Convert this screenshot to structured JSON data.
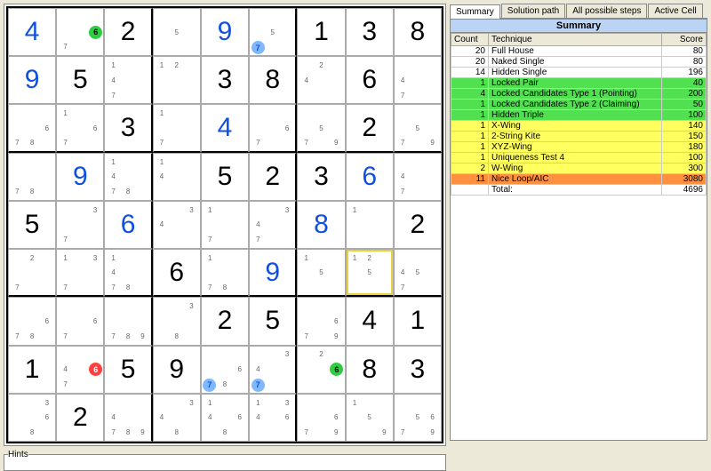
{
  "tabs": {
    "t0": "Summary",
    "t1": "Solution path",
    "t2": "All possible steps",
    "t3": "Active Cell"
  },
  "summary_header": "Summary",
  "columns": {
    "count": "Count",
    "tech": "Technique",
    "score": "Score"
  },
  "rows": [
    {
      "c": "20",
      "t": "Full House",
      "s": "80",
      "cls": "row-white"
    },
    {
      "c": "20",
      "t": "Naked Single",
      "s": "80",
      "cls": "row-white"
    },
    {
      "c": "14",
      "t": "Hidden Single",
      "s": "196",
      "cls": "row-white"
    },
    {
      "c": "1",
      "t": "Locked Pair",
      "s": "40",
      "cls": "row-green"
    },
    {
      "c": "4",
      "t": "Locked Candidates Type 1 (Pointing)",
      "s": "200",
      "cls": "row-green"
    },
    {
      "c": "1",
      "t": "Locked Candidates Type 2 (Claiming)",
      "s": "50",
      "cls": "row-green"
    },
    {
      "c": "1",
      "t": "Hidden Triple",
      "s": "100",
      "cls": "row-green"
    },
    {
      "c": "1",
      "t": "X-Wing",
      "s": "140",
      "cls": "row-yellow"
    },
    {
      "c": "1",
      "t": "2-String Kite",
      "s": "150",
      "cls": "row-yellow"
    },
    {
      "c": "1",
      "t": "XYZ-Wing",
      "s": "180",
      "cls": "row-yellow"
    },
    {
      "c": "1",
      "t": "Uniqueness Test 4",
      "s": "100",
      "cls": "row-yellow"
    },
    {
      "c": "2",
      "t": "W-Wing",
      "s": "300",
      "cls": "row-yellow"
    },
    {
      "c": "11",
      "t": "Nice Loop/AIC",
      "s": "3080",
      "cls": "row-orange"
    },
    {
      "c": "",
      "t": "Total:",
      "s": "4696",
      "cls": "row-white"
    }
  ],
  "hints_label": "Hints",
  "sudoku": {
    "rows": [
      [
        {
          "v": "4",
          "c": "blue"
        },
        {
          "cand": [
            "",
            "",
            "",
            "",
            "",
            "",
            "7",
            ""
          ],
          "circ": {
            "n": "6",
            "pos": [
              1,
              2
            ],
            "col": "green"
          }
        },
        {
          "v": "2",
          "c": "black"
        },
        {
          "cand": [
            "",
            "",
            "",
            "",
            "5",
            "",
            "",
            "",
            ""
          ]
        },
        {
          "v": "9",
          "c": "blue"
        },
        {
          "cand": [
            "",
            "",
            "",
            "",
            "5",
            "",
            "7",
            "",
            ""
          ],
          "circ": {
            "n": "7",
            "pos": [
              2,
              0
            ],
            "col": "blue"
          }
        },
        {
          "v": "1",
          "c": "black"
        },
        {
          "v": "3",
          "c": "black"
        },
        {
          "v": "8",
          "c": "black"
        }
      ],
      [
        {
          "v": "9",
          "c": "blue"
        },
        {
          "v": "5",
          "c": "black"
        },
        {
          "cand": [
            "1",
            "",
            "",
            "4",
            "",
            "",
            "7",
            "",
            ""
          ]
        },
        {
          "cand": [
            "1",
            "2",
            "",
            "",
            "",
            "",
            "",
            "",
            ""
          ]
        },
        {
          "v": "3",
          "c": "black"
        },
        {
          "v": "8",
          "c": "black"
        },
        {
          "cand": [
            "",
            "2",
            "",
            "4",
            "",
            "",
            "",
            "",
            ""
          ]
        },
        {
          "v": "6",
          "c": "black"
        },
        {
          "cand": [
            "",
            "",
            "",
            "4",
            "",
            "",
            "7",
            "",
            ""
          ]
        }
      ],
      [
        {
          "cand": [
            "",
            "",
            "",
            "",
            "",
            "6",
            "7",
            "8",
            ""
          ]
        },
        {
          "cand": [
            "1",
            "",
            "",
            "",
            "",
            "6",
            "7",
            "",
            ""
          ]
        },
        {
          "v": "3",
          "c": "black"
        },
        {
          "cand": [
            "1",
            "",
            "",
            "",
            "",
            "",
            "7",
            "",
            ""
          ]
        },
        {
          "v": "4",
          "c": "blue"
        },
        {
          "cand": [
            "",
            "",
            "",
            "",
            "",
            "6",
            "7",
            "",
            ""
          ]
        },
        {
          "cand": [
            "",
            "",
            "",
            "",
            "5",
            "",
            "7",
            "",
            "9"
          ]
        },
        {
          "v": "2",
          "c": "black"
        },
        {
          "cand": [
            "",
            "",
            "",
            "",
            "5",
            "",
            "7",
            "",
            "9"
          ]
        }
      ],
      [
        {
          "cand": [
            "",
            "",
            "",
            "",
            "",
            "",
            "7",
            "8",
            ""
          ]
        },
        {
          "v": "9",
          "c": "blue"
        },
        {
          "cand": [
            "1",
            "",
            "",
            "4",
            "",
            "",
            "7",
            "8",
            ""
          ]
        },
        {
          "cand": [
            "1",
            "",
            "",
            "4",
            "",
            "",
            "",
            "",
            ""
          ]
        },
        {
          "v": "5",
          "c": "black"
        },
        {
          "v": "2",
          "c": "black"
        },
        {
          "v": "3",
          "c": "black"
        },
        {
          "v": "6",
          "c": "blue"
        },
        {
          "cand": [
            "",
            "",
            "",
            "4",
            "",
            "",
            "7",
            "",
            ""
          ]
        }
      ],
      [
        {
          "v": "5",
          "c": "black"
        },
        {
          "cand": [
            "",
            "",
            "3",
            "",
            "",
            "",
            "7",
            "",
            ""
          ]
        },
        {
          "v": "6",
          "c": "blue"
        },
        {
          "cand": [
            "",
            "",
            "3",
            "4",
            "",
            "",
            "",
            "",
            ""
          ]
        },
        {
          "cand": [
            "1",
            "",
            "",
            "",
            "",
            "",
            "7",
            "",
            ""
          ]
        },
        {
          "cand": [
            "",
            "",
            "3",
            "4",
            "",
            "",
            "7",
            "",
            ""
          ]
        },
        {
          "v": "8",
          "c": "blue"
        },
        {
          "cand": [
            "1",
            "",
            "",
            "",
            "",
            "",
            "",
            "",
            ""
          ]
        },
        {
          "v": "2",
          "c": "black"
        }
      ],
      [
        {
          "cand": [
            "",
            "2",
            "",
            "",
            "",
            "",
            "7",
            "",
            ""
          ]
        },
        {
          "cand": [
            "1",
            "",
            "3",
            "",
            "",
            "",
            "7",
            "",
            ""
          ]
        },
        {
          "cand": [
            "1",
            "",
            "",
            "4",
            "",
            "",
            "7",
            "8",
            ""
          ]
        },
        {
          "v": "6",
          "c": "black"
        },
        {
          "cand": [
            "1",
            "",
            "",
            "",
            "",
            "",
            "7",
            "8",
            ""
          ]
        },
        {
          "v": "9",
          "c": "blue"
        },
        {
          "cand": [
            "1",
            "",
            "",
            "",
            "5",
            "",
            "",
            "",
            ""
          ]
        },
        {
          "cand": [
            "1",
            "2",
            "",
            "",
            "5",
            "",
            "",
            "",
            ""
          ],
          "hl": true
        },
        {
          "cand": [
            "",
            "",
            "",
            "4",
            "5",
            "",
            "7",
            "",
            ""
          ]
        }
      ],
      [
        {
          "cand": [
            "",
            "",
            "",
            "",
            "",
            "6",
            "7",
            "8",
            ""
          ]
        },
        {
          "cand": [
            "",
            "",
            "",
            "",
            "",
            "6",
            "7",
            "",
            ""
          ]
        },
        {
          "cand": [
            "",
            "",
            "",
            "",
            "",
            "",
            "7",
            "8",
            "9"
          ]
        },
        {
          "cand": [
            "",
            "",
            "3",
            "",
            "",
            "",
            "",
            "8",
            ""
          ]
        },
        {
          "v": "2",
          "c": "black"
        },
        {
          "v": "5",
          "c": "black"
        },
        {
          "cand": [
            "",
            "",
            "",
            "",
            "",
            "6",
            "7",
            "",
            "9"
          ]
        },
        {
          "v": "4",
          "c": "black"
        },
        {
          "v": "1",
          "c": "black"
        }
      ],
      [
        {
          "v": "1",
          "c": "black"
        },
        {
          "cand": [
            "",
            "",
            "",
            "4",
            "",
            "",
            "7",
            "",
            ""
          ],
          "circ": {
            "n": "6",
            "pos": [
              1,
              2
            ],
            "col": "red"
          }
        },
        {
          "v": "5",
          "c": "black"
        },
        {
          "v": "9",
          "c": "black"
        },
        {
          "cand": [
            "",
            "",
            "",
            "",
            "",
            "6",
            "",
            "8",
            ""
          ],
          "circ": {
            "n": "7",
            "pos": [
              2,
              0
            ],
            "col": "blue"
          }
        },
        {
          "cand": [
            "",
            "",
            "3",
            "4",
            "",
            "",
            "",
            "",
            ""
          ],
          "circ": {
            "n": "7",
            "pos": [
              2,
              0
            ],
            "col": "blue"
          }
        },
        {
          "cand": [
            "",
            "2",
            "",
            "",
            "",
            "",
            "",
            "",
            ""
          ],
          "circ": {
            "n": "6",
            "pos": [
              1,
              2
            ],
            "col": "green"
          }
        },
        {
          "v": "8",
          "c": "black"
        },
        {
          "v": "3",
          "c": "black"
        }
      ],
      [
        {
          "cand": [
            "",
            "",
            "3",
            "",
            "",
            "6",
            "",
            "8",
            ""
          ]
        },
        {
          "v": "2",
          "c": "black"
        },
        {
          "cand": [
            "",
            "",
            "",
            "4",
            "",
            "",
            "7",
            "8",
            "9"
          ]
        },
        {
          "cand": [
            "",
            "",
            "3",
            "4",
            "",
            "",
            "",
            "8",
            ""
          ]
        },
        {
          "cand": [
            "1",
            "",
            "",
            "4",
            "",
            "6",
            "",
            "8",
            ""
          ]
        },
        {
          "cand": [
            "1",
            "",
            "3",
            "4",
            "",
            "6",
            "",
            "",
            ""
          ]
        },
        {
          "cand": [
            "",
            "",
            "",
            "",
            "",
            "6",
            "7",
            "",
            "9"
          ]
        },
        {
          "cand": [
            "1",
            "",
            "",
            "",
            "5",
            "",
            "",
            "",
            "9"
          ]
        },
        {
          "cand": [
            "",
            "",
            "",
            "",
            "5",
            "6",
            "7",
            "",
            "9"
          ]
        }
      ]
    ]
  }
}
